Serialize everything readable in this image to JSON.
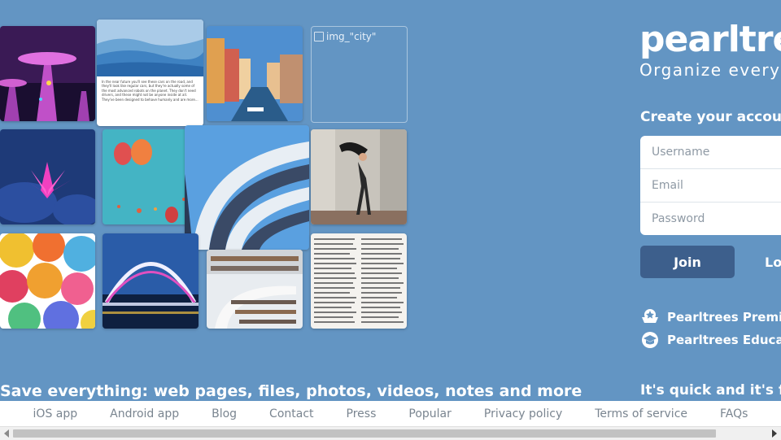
{
  "mosaic": {
    "broken_image_alt": "img_\"city\""
  },
  "tagline": "Save everything: web pages, files, photos, videos, notes and more",
  "brand": {
    "logo_text": "pearltrees",
    "slogan": "Organize everything"
  },
  "signup": {
    "heading": "Create your account",
    "username_placeholder": "Username",
    "email_placeholder": "Email",
    "password_placeholder": "Password",
    "join_label": "Join",
    "login_label": "Log in"
  },
  "promos": [
    {
      "label": "Pearltrees Premium",
      "icon": "premium-star-icon"
    },
    {
      "label": "Pearltrees Education",
      "icon": "graduation-cap-icon"
    }
  ],
  "quick_text": "It's quick and it's free!",
  "footer": {
    "links": [
      "iOS app",
      "Android app",
      "Blog",
      "Contact",
      "Press",
      "Popular",
      "Privacy policy",
      "Terms of service",
      "FAQs"
    ]
  },
  "colors": {
    "background": "#6395c3",
    "join_button": "#3d5f8c",
    "footer_text": "#7a8590"
  }
}
